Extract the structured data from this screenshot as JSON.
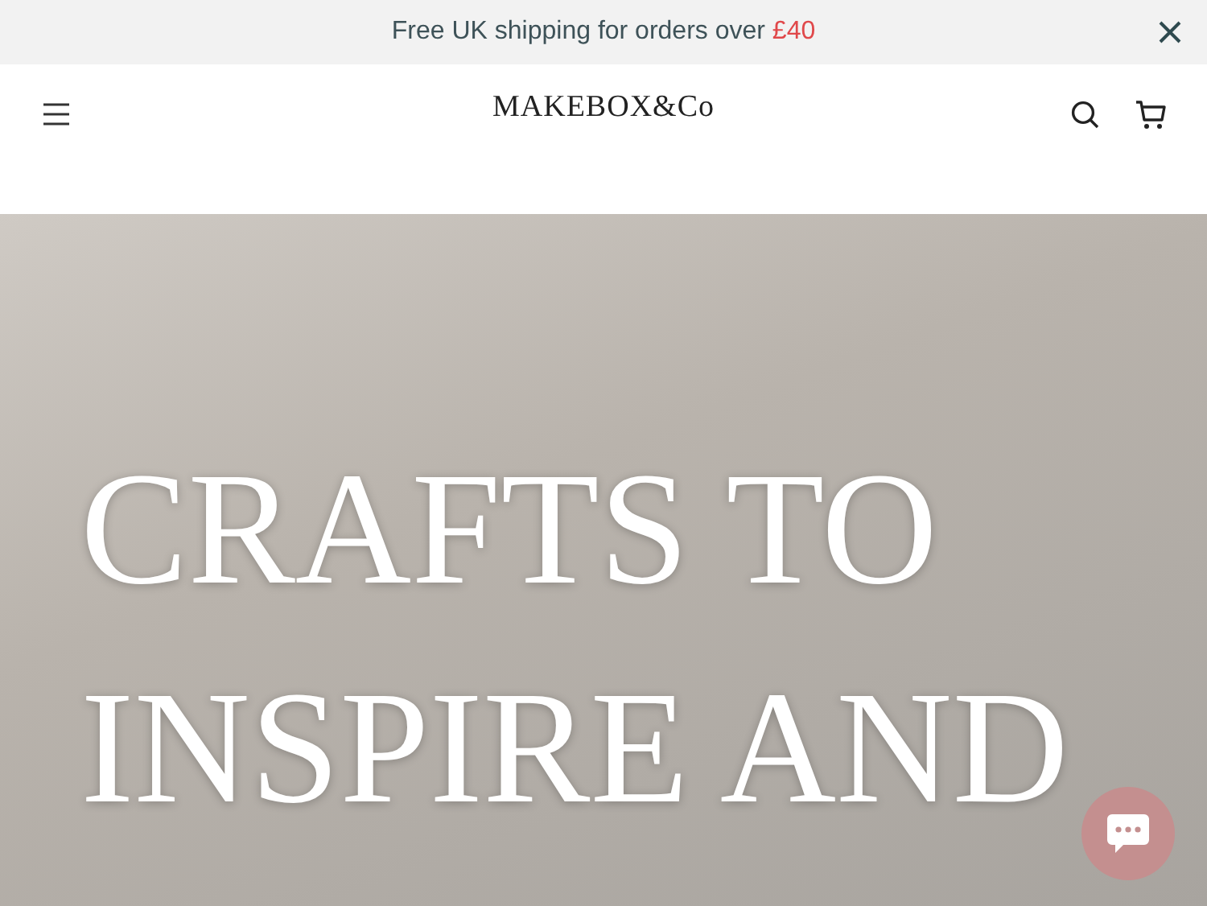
{
  "announcement": {
    "text": "Free UK shipping for orders over **£40**"
  },
  "header": {
    "logo": "MAKEBOX&Co"
  },
  "hero": {
    "heading": "CRAFTS TO INSPIRE AND"
  }
}
